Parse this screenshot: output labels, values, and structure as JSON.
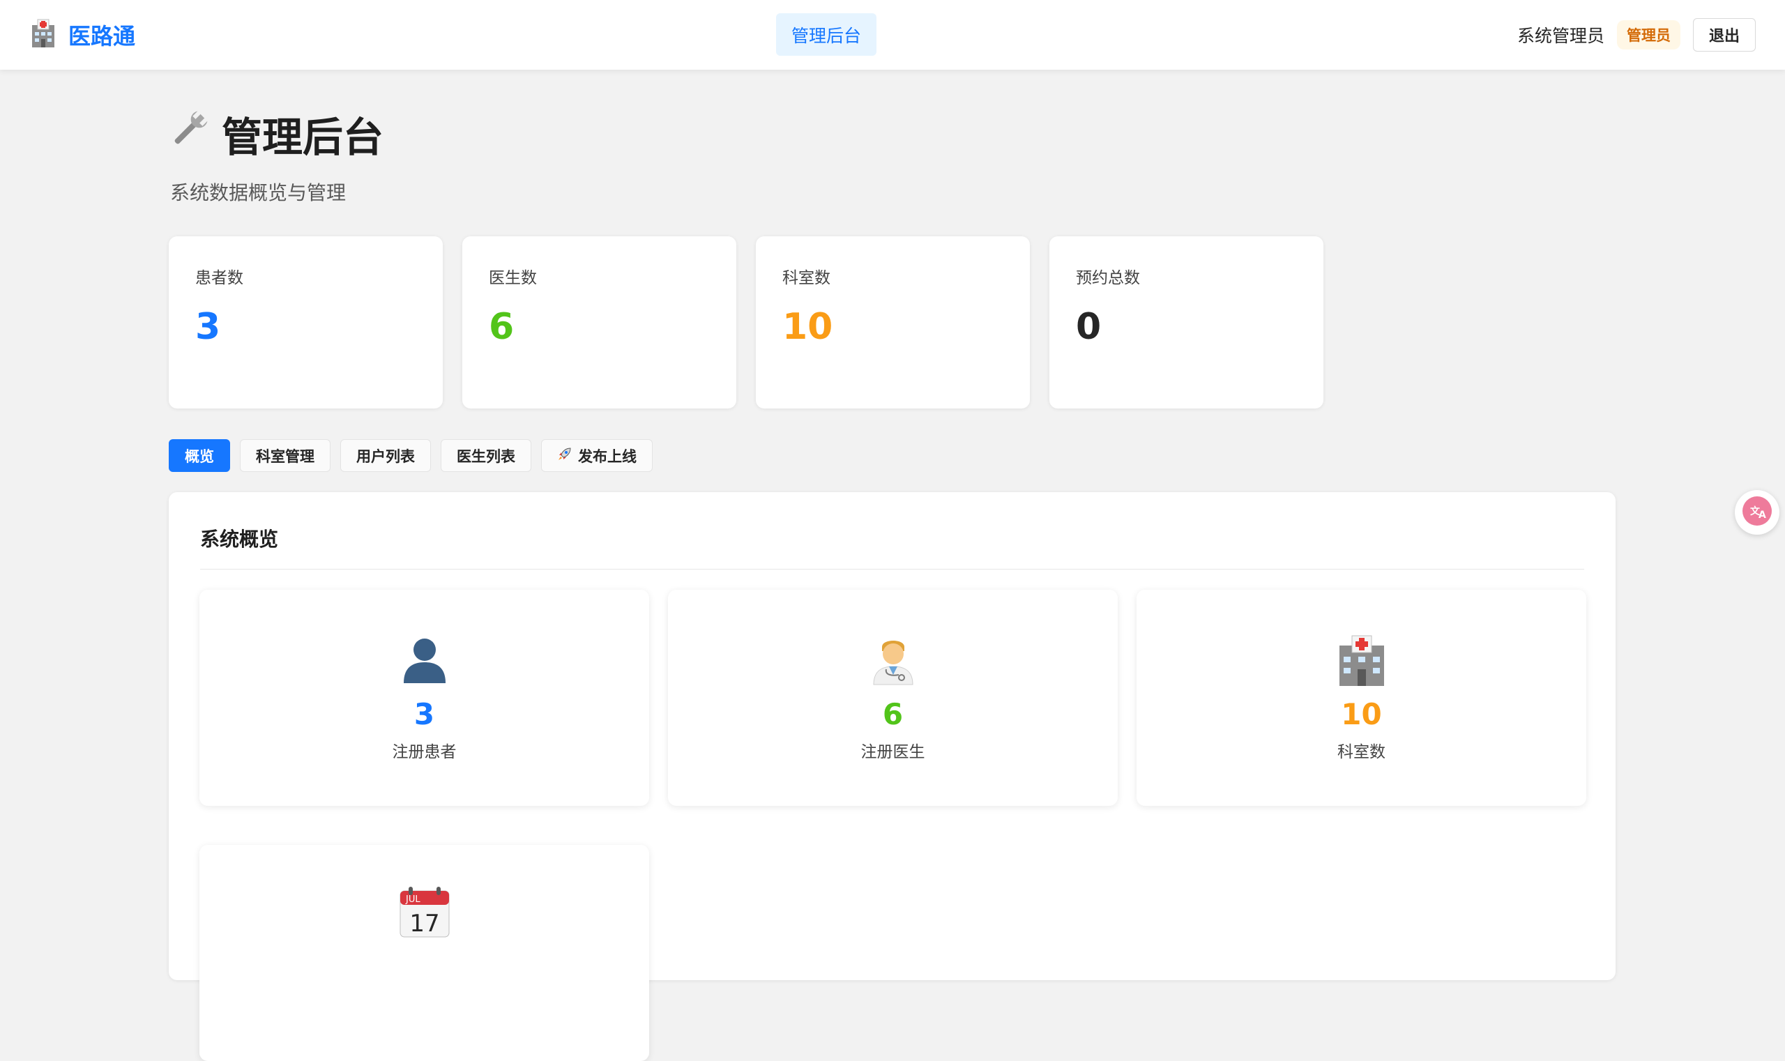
{
  "header": {
    "brand": "医路通",
    "nav_active": "管理后台",
    "user_name": "系统管理员",
    "role_tag": "管理员",
    "logout": "退出"
  },
  "page": {
    "title": "管理后台",
    "subtitle": "系统数据概览与管理"
  },
  "stats": [
    {
      "label": "患者数",
      "value": "3",
      "color": "#1677ff"
    },
    {
      "label": "医生数",
      "value": "6",
      "color": "#52c41a"
    },
    {
      "label": "科室数",
      "value": "10",
      "color": "#fa9c16"
    },
    {
      "label": "预约总数",
      "value": "0",
      "color": "#262626"
    }
  ],
  "tabs": [
    {
      "label": "概览",
      "active": true
    },
    {
      "label": "科室管理"
    },
    {
      "label": "用户列表"
    },
    {
      "label": "医生列表"
    },
    {
      "label": "发布上线",
      "icon": "rocket-icon"
    }
  ],
  "overview": {
    "title": "系统概览",
    "cards": [
      {
        "icon": "patient-icon",
        "value": "3",
        "label": "注册患者",
        "color": "#1677ff"
      },
      {
        "icon": "doctor-icon",
        "value": "6",
        "label": "注册医生",
        "color": "#52c41a"
      },
      {
        "icon": "hospital-icon",
        "value": "10",
        "label": "科室数",
        "color": "#fa9c16"
      },
      {
        "icon": "calendar-icon",
        "calendar_month": "JUL",
        "calendar_day": "17"
      }
    ]
  }
}
